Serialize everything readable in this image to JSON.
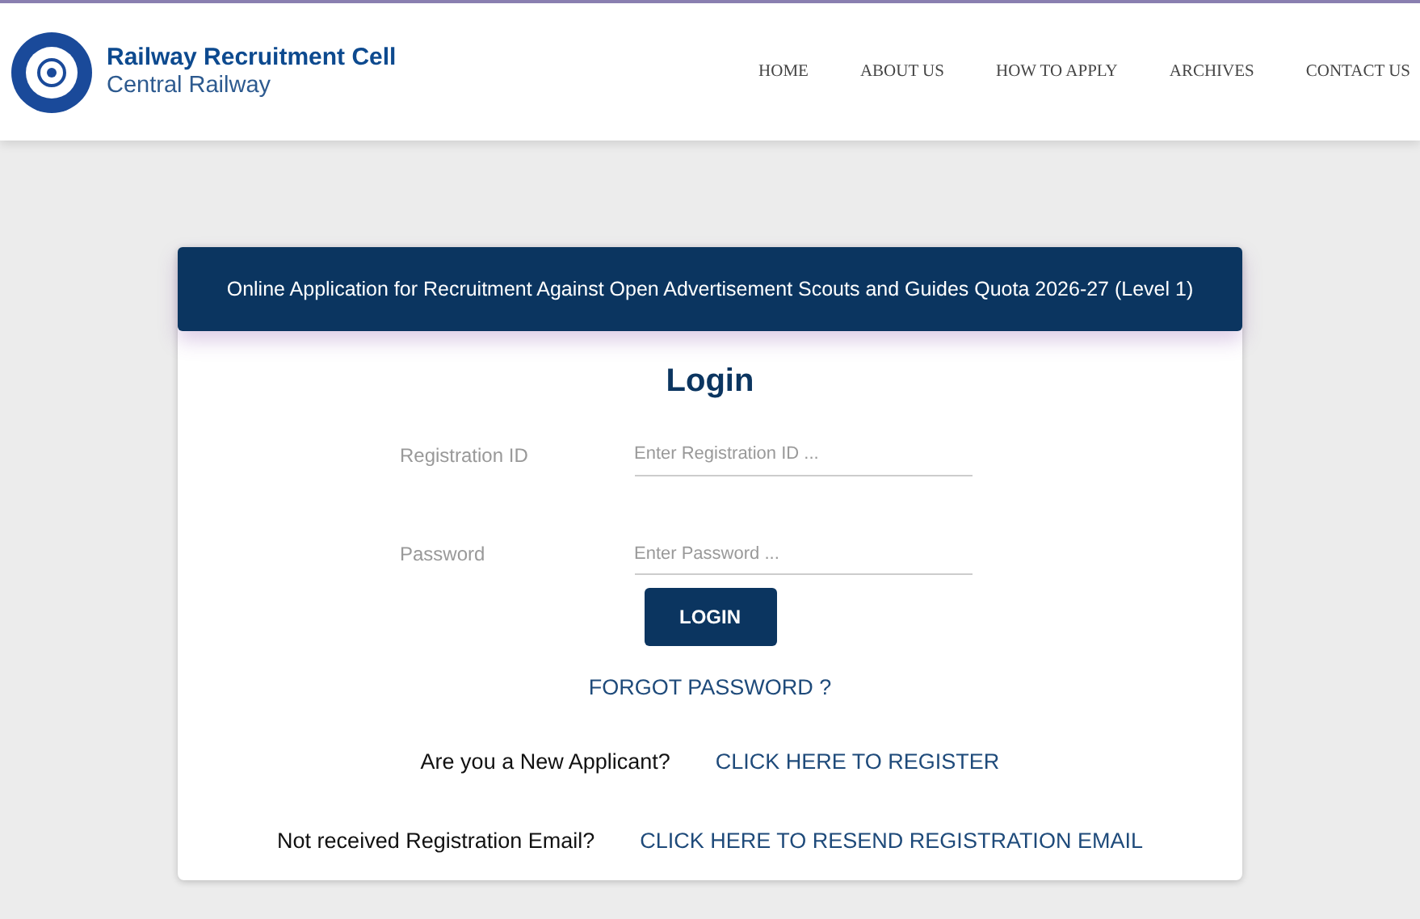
{
  "header": {
    "title": "Railway Recruitment Cell",
    "subtitle": "Central Railway"
  },
  "nav": [
    "HOME",
    "ABOUT US",
    "HOW TO APPLY",
    "ARCHIVES",
    "CONTACT US"
  ],
  "banner": "Online Application for Recruitment Against Open Advertisement Scouts and Guides Quota 2026-27 (Level 1)",
  "login": {
    "title": "Login",
    "fields": [
      {
        "label": "Registration ID",
        "placeholder": "Enter Registration ID ..."
      },
      {
        "label": "Password",
        "placeholder": "Enter Password ..."
      }
    ],
    "button": "LOGIN",
    "forgot": "FORGOT PASSWORD ?",
    "links": [
      {
        "prompt": "Are you a New Applicant?",
        "link": "CLICK HERE TO REGISTER"
      },
      {
        "prompt": "Not received Registration Email?",
        "link": "CLICK HERE TO RESEND REGISTRATION EMAIL"
      }
    ]
  }
}
